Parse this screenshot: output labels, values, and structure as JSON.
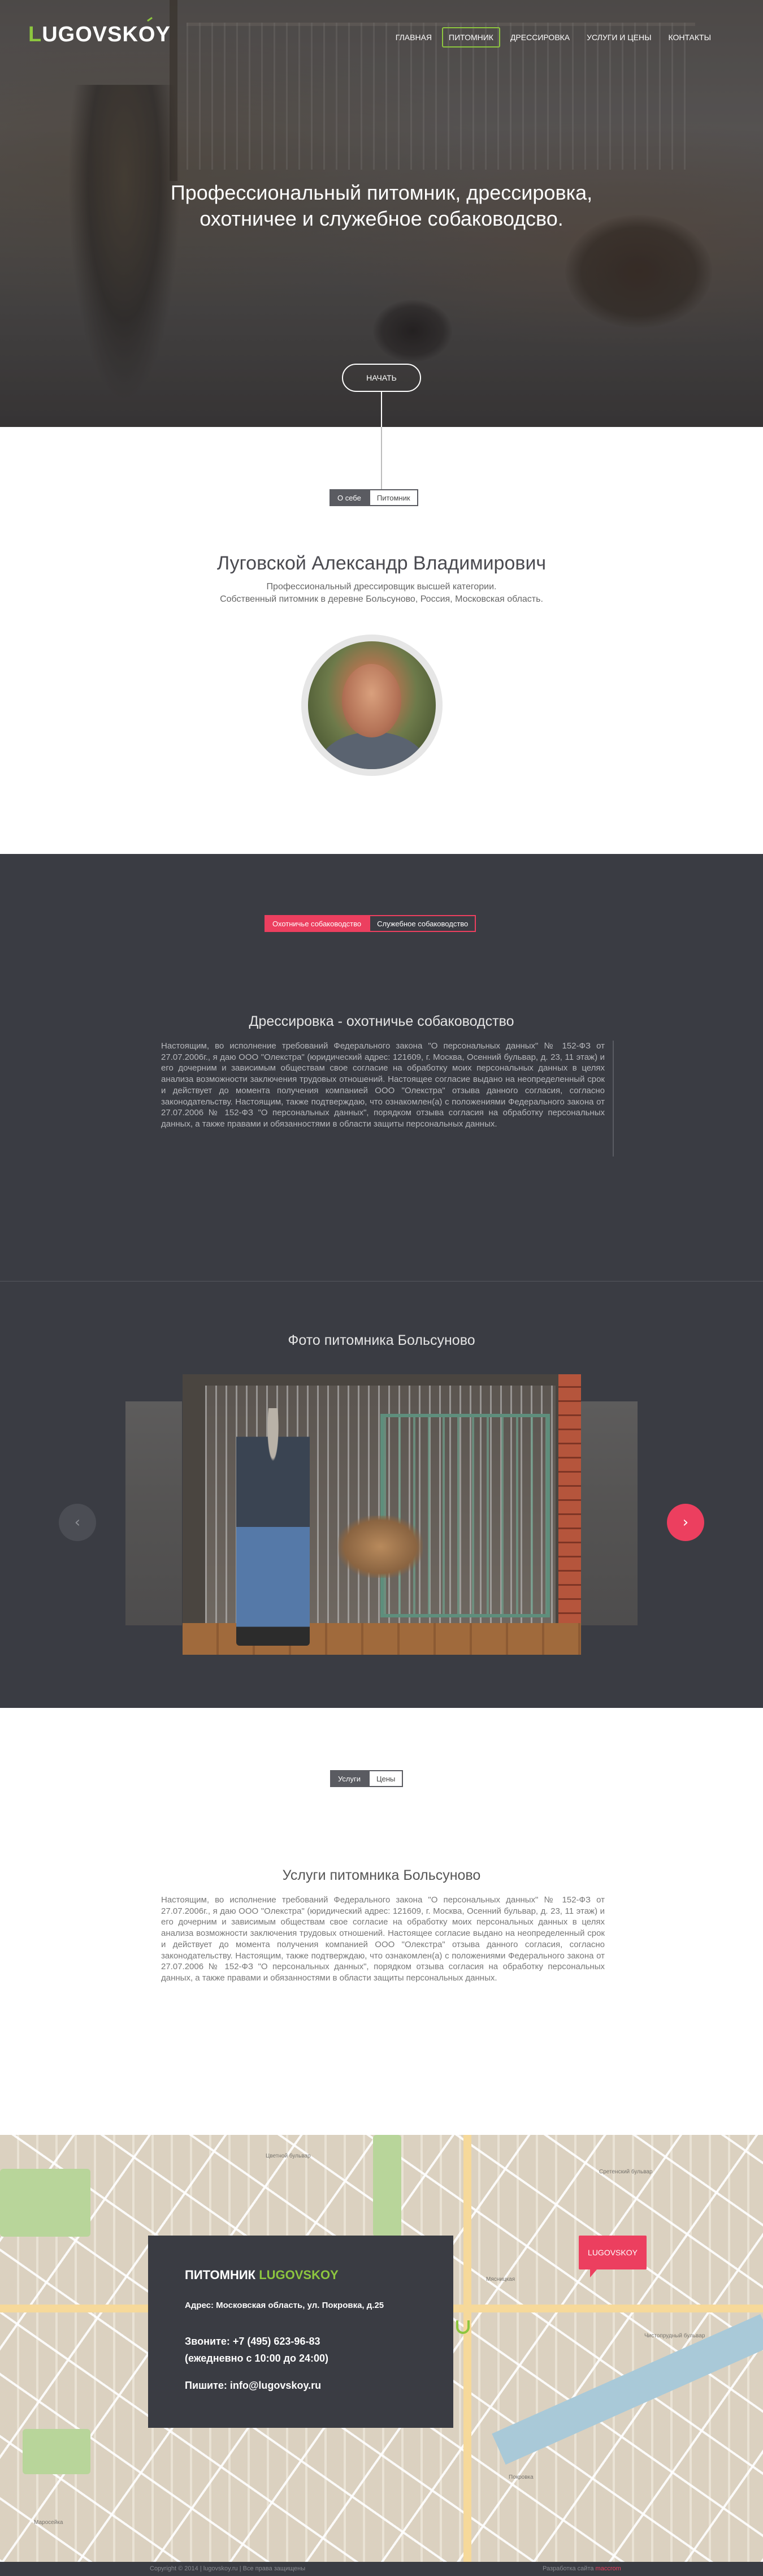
{
  "header": {
    "logo_first": "L",
    "logo_rest": "UGOVSKOY",
    "nav": [
      {
        "label": "Главная",
        "active": false
      },
      {
        "label": "Питомник",
        "active": true
      },
      {
        "label": "Дрессировка",
        "active": false
      },
      {
        "label": "Услуги и цены",
        "active": false
      },
      {
        "label": "Контакты",
        "active": false
      }
    ]
  },
  "hero": {
    "title_lines": [
      "Профессиональный питомник, дрессировка,",
      "охотничее и служебное собаководсво."
    ],
    "start_button": "Начать"
  },
  "about": {
    "tabs": [
      {
        "label": "О себе",
        "active": true
      },
      {
        "label": "Питомник",
        "active": false
      }
    ],
    "name": "Луговской Александр Владимирович",
    "sub_lines": [
      "Профессиональный дрессировщик высшей категории.",
      "Собственный питомник в деревне Больсуново, Россия, Московская область."
    ]
  },
  "training": {
    "tabs": [
      {
        "label": "Охотничье собаководство",
        "active": true
      },
      {
        "label": "Служебное собаководство",
        "active": false
      }
    ],
    "title": "Дрессировка - охотничье собаководство",
    "text": "Настоящим, во исполнение требований Федерального закона \"О персональных данных\" № 152-ФЗ от 27.07.2006г., я даю ООО \"Олекстра\" (юридический адрес: 121609, г. Москва, Осенний бульвар, д. 23, 11 этаж) и его дочерним и зависимым обществам свое согласие на обработку моих персональных данных в целях анализа возможности заключения трудовых отношений. Настоящее согласие выдано на неопределенный срок и действует до момента получения компанией ООО \"Олекстра\" отзыва данного согласия, согласно законодательству. Настоящим, также подтверждаю, что ознакомлен(а) с положениями Федерального закона от 27.07.2006 № 152-ФЗ \"О персональных данных\", порядком отзыва согласия на обработку персональных данных, а также правами и обязанностями в области защиты персональных данных."
  },
  "gallery": {
    "title": "Фото питомника Больсуново",
    "prev_icon": "‹",
    "next_icon": "›"
  },
  "services": {
    "tabs": [
      {
        "label": "Услуги",
        "active": true
      },
      {
        "label": "Цены",
        "active": false
      }
    ],
    "title": "Услуги  питомника Больсуново",
    "text": "Настоящим, во исполнение требований Федерального закона \"О персональных данных\" № 152-ФЗ от 27.07.2006г., я даю ООО \"Олекстра\" (юридический адрес: 121609, г. Москва, Осенний бульвар, д. 23, 11 этаж) и его дочерним и зависимым обществам свое согласие на обработку моих персональных данных в целях анализа возможности заключения трудовых отношений. Настоящее согласие выдано на неопределенный срок и действует до момента получения компанией ООО \"Олекстра\" отзыва данного согласия, согласно законодательству. Настоящим, также подтверждаю, что ознакомлен(а) с положениями Федерального закона от 27.07.2006 № 152-ФЗ \"О персональных данных\", порядком отзыва согласия на обработку персональных данных, а также правами и обязанностями в области защиты персональных данных."
  },
  "contacts": {
    "title_prefix": "ПИТОМНИК ",
    "title_brand": "LUGOVSKOY",
    "address": "Адрес: Московская область, ул. Покровка, д.25",
    "phone_lines": [
      "Звоните: +7 (495) 623-96-83",
      "(ежедневно с 10:00 до 24:00)"
    ],
    "email": "Пишите: info@lugovskoy.ru",
    "marker": "LUGOVSKOY",
    "map_labels": [
      "Цветной бульвар",
      "Сретенский бульвар",
      "Мясницкая",
      "Покровка",
      "Чистопрудный бульвар",
      "Маросейка"
    ]
  },
  "footer": {
    "copyright": "Copyright © 2014 | lugovskoy.ru | Все права защищены",
    "dev_prefix": "Разработка сайта ",
    "dev_brand": "maccrom"
  },
  "colors": {
    "accent_green": "#8dc63f",
    "accent_red": "#ec3f5f",
    "dark": "#3a3c43"
  }
}
